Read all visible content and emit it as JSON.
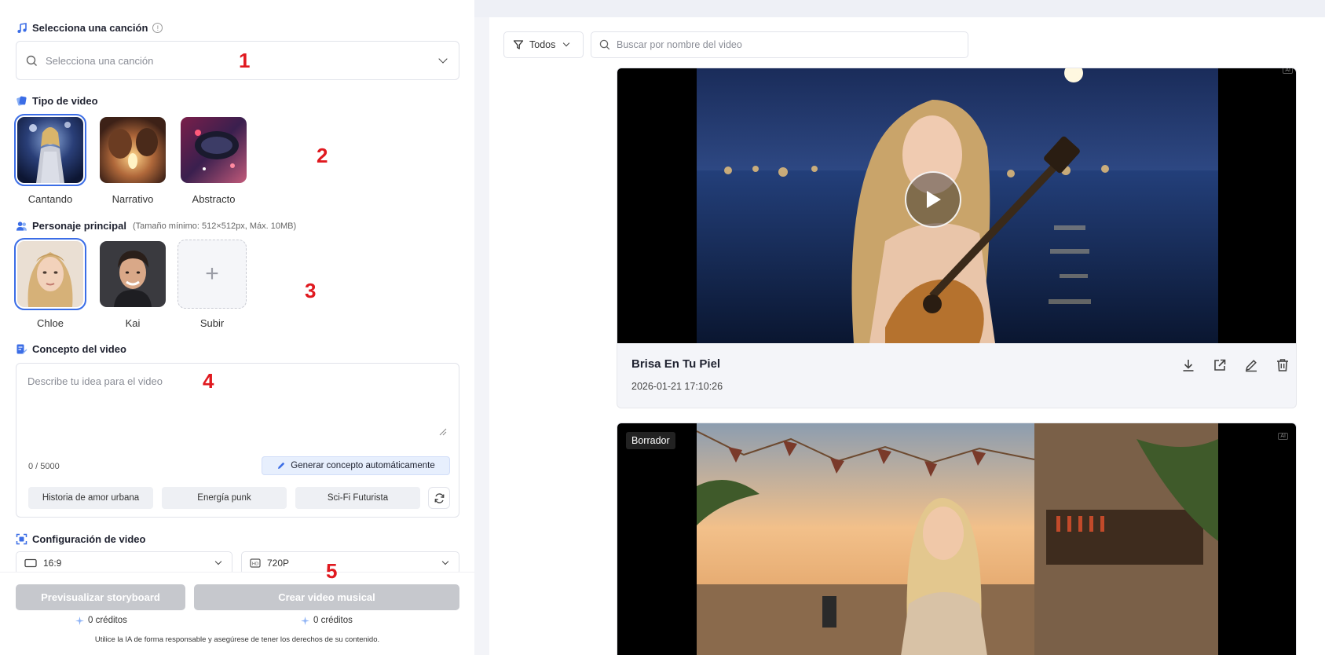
{
  "colors": {
    "accent": "#3b6de6",
    "annotation_red": "#e0191f",
    "disabled_button": "#c6c8cd"
  },
  "song": {
    "title": "Selecciona una canción",
    "placeholder": "Selecciona una canción",
    "annotation": "1"
  },
  "video_type": {
    "title": "Tipo de video",
    "annotation": "2",
    "options": [
      {
        "label": "Cantando",
        "selected": true
      },
      {
        "label": "Narrativo",
        "selected": false
      },
      {
        "label": "Abstracto",
        "selected": false
      }
    ]
  },
  "character": {
    "title": "Personaje principal",
    "subtitle": "(Tamaño mínimo: 512×512px, Máx. 10MB)",
    "annotation": "3",
    "options": [
      {
        "label": "Chloe",
        "selected": true
      },
      {
        "label": "Kai",
        "selected": false
      },
      {
        "label": "Subir",
        "selected": false
      }
    ]
  },
  "concept": {
    "title": "Concepto del video",
    "placeholder": "Describe tu idea para el video",
    "annotation": "4",
    "counter": "0 / 5000",
    "generate_label": "Generar concepto automáticamente",
    "suggestions": [
      "Historia de amor urbana",
      "Energía punk",
      "Sci-Fi Futurista"
    ]
  },
  "config": {
    "title": "Configuración de video",
    "aspect_ratio": "16:9",
    "resolution": "720P",
    "annotation": "5"
  },
  "actions": {
    "preview_label": "Previsualizar storyboard",
    "create_label": "Crear video musical",
    "preview_credits": "0 créditos",
    "create_credits": "0 créditos",
    "disclaimer": "Utilice la IA de forma responsable y asegúrese de tener los derechos de su contenido."
  },
  "gallery": {
    "filter_label": "Todos",
    "search_placeholder": "Buscar por nombre del video",
    "videos": [
      {
        "title": "Brisa En Tu Piel",
        "date": "2026-01-21 17:10:26"
      },
      {
        "badge": "Borrador",
        "ai_tag": "AI"
      }
    ]
  }
}
